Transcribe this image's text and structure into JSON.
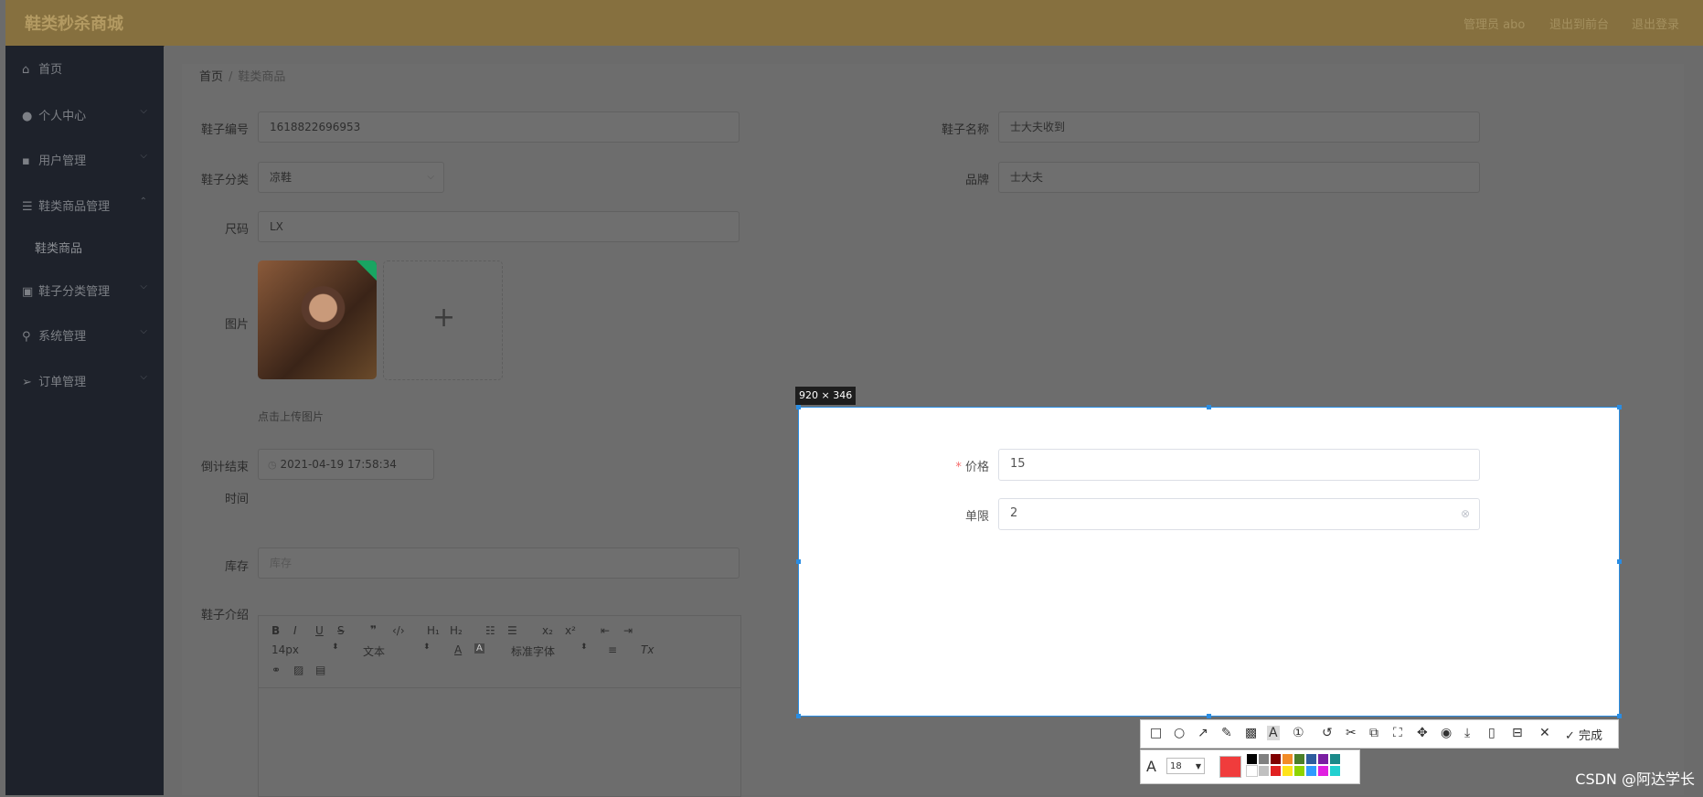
{
  "header": {
    "brand": "鞋类秒杀商城",
    "admin_text": "管理员 abo",
    "exit_to_front": "退出到前台",
    "logout": "退出登录"
  },
  "sidebar": {
    "items": [
      {
        "label": "首页",
        "icon": "home-icon"
      },
      {
        "label": "个人中心",
        "icon": "user-icon"
      },
      {
        "label": "用户管理",
        "icon": "users-icon"
      },
      {
        "label": "鞋类商品管理",
        "icon": "list-icon"
      },
      {
        "label": "鞋子分类管理",
        "icon": "category-icon"
      },
      {
        "label": "系统管理",
        "icon": "location-icon"
      },
      {
        "label": "订单管理",
        "icon": "send-icon"
      }
    ],
    "subitem": "鞋类商品"
  },
  "breadcrumb": {
    "home": "首页",
    "sep": "/",
    "current": "鞋类商品"
  },
  "form": {
    "shoe_no_label": "鞋子编号",
    "shoe_no_value": "1618822696953",
    "shoe_name_label": "鞋子名称",
    "shoe_name_value": "士大夫收到",
    "category_label": "鞋子分类",
    "category_value": "凉鞋",
    "brand_label": "品牌",
    "brand_value": "士大夫",
    "size_label": "尺码",
    "size_value": "LX",
    "image_label": "图片",
    "upload_hint": "点击上传图片",
    "countdown_label_1": "倒计结束",
    "countdown_label_2": "时间",
    "countdown_value": "2021-04-19 17:58:34",
    "stock_label": "库存",
    "stock_placeholder": "库存",
    "intro_label": "鞋子介绍"
  },
  "editor": {
    "font_size": "14px",
    "text_style": "文本",
    "font_family": "标准字体"
  },
  "capture": {
    "size_tag_w": "920",
    "size_tag_x": "×",
    "size_tag_h": "346",
    "price_required": "*",
    "price_label": "价格",
    "price_value": "15",
    "limit_label": "单限",
    "limit_value": "2"
  },
  "shot_toolbar": {
    "done_label": "完成",
    "font_size_value": "18",
    "current_color": "#f03c3c",
    "palette": [
      "#000000",
      "#808080",
      "#800000",
      "#f28c28",
      "#4b7f2a",
      "#2e5c9e",
      "#7a1fa2",
      "#1b8a8a",
      "#ffffff",
      "#c0c0c0",
      "#e02020",
      "#ffe31a",
      "#8fd400",
      "#2f9bff",
      "#e020e0",
      "#22d0d0"
    ]
  },
  "watermark": "CSDN @阿达学长"
}
